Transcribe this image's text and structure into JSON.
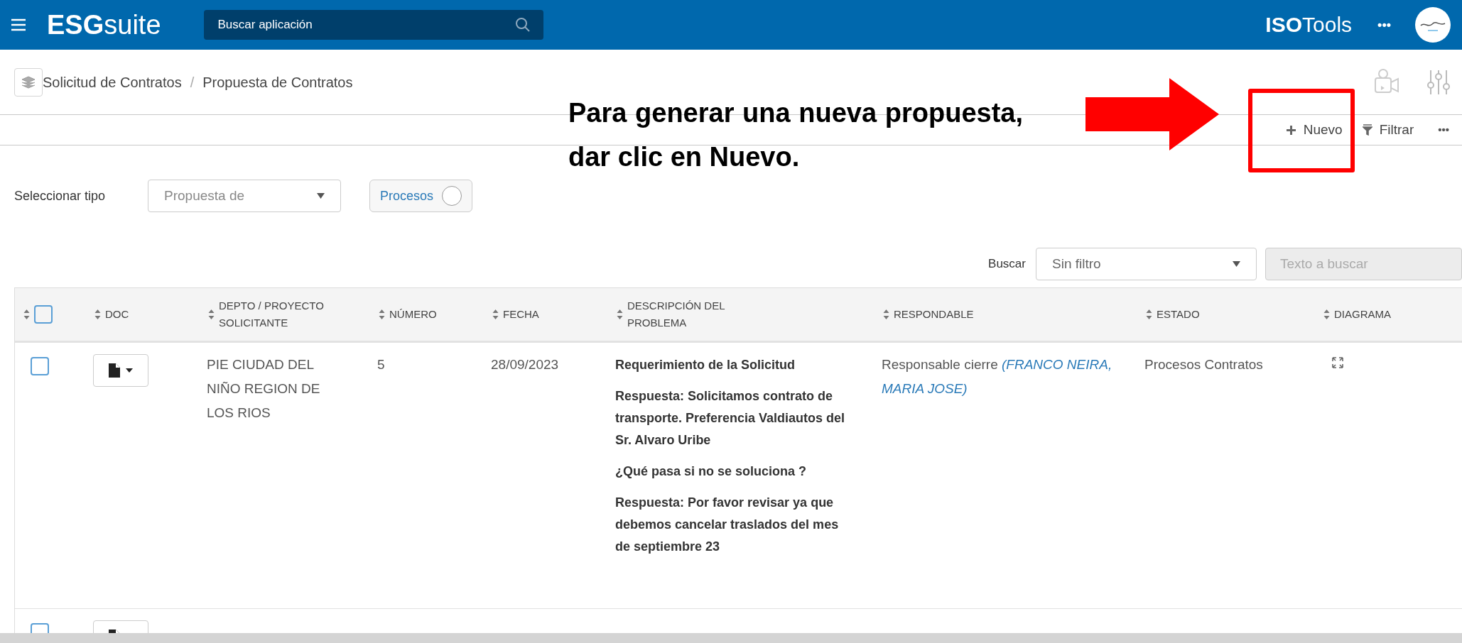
{
  "header": {
    "logo_bold": "ESG",
    "logo_light": "suite",
    "search_placeholder": "Buscar aplicación",
    "brand_bold": "ISO",
    "brand_light": "Tools",
    "more": "•••"
  },
  "breadcrumb": {
    "items": [
      "Solicitud de Contratos",
      "Propuesta de Contratos"
    ],
    "separator": "/"
  },
  "toolbar": {
    "items": [
      {
        "kind": "new",
        "label": "Nuevo"
      },
      {
        "kind": "filter",
        "label": "Filtrar"
      }
    ],
    "more": "•••"
  },
  "annotation": {
    "text": "Para generar una nueva propuesta, dar clic en Nuevo."
  },
  "type_selector": {
    "label": "Seleccionar tipo",
    "value": "Propuesta de",
    "toggle": {
      "label": "Procesos",
      "on": false
    }
  },
  "search": {
    "label": "Buscar",
    "filter": "Sin filtro",
    "placeholder": "Texto a buscar"
  },
  "table": {
    "header_checked": false,
    "columns": [
      "DOC",
      "DEPTO / PROYECTO SOLICITANTE",
      "NÚMERO",
      "FECHA",
      "DESCRIPCIÓN DEL PROBLEMA",
      "RESPONDABLE",
      "ESTADO",
      "DIAGRAMA"
    ],
    "rows": [
      {
        "checked": false,
        "depto": "PIE CIUDAD DEL NIÑO REGION DE LOS RIOS",
        "numero": "5",
        "fecha": "28/09/2023",
        "descripcion": [
          "Requerimiento de la Solicitud",
          "Respuesta: Solicitamos contrato de transporte. Preferencia Valdiautos del Sr. Alvaro Uribe",
          "¿Qué pasa si no se soluciona ?",
          "Respuesta: Por favor revisar ya que debemos cancelar traslados del mes de septiembre 23"
        ],
        "responsable": "Responsable cierre",
        "responsable_person": "(FRANCO NEIRA, MARIA JOSE)",
        "estado": "Procesos Contratos"
      },
      {
        "checked": false
      }
    ]
  }
}
